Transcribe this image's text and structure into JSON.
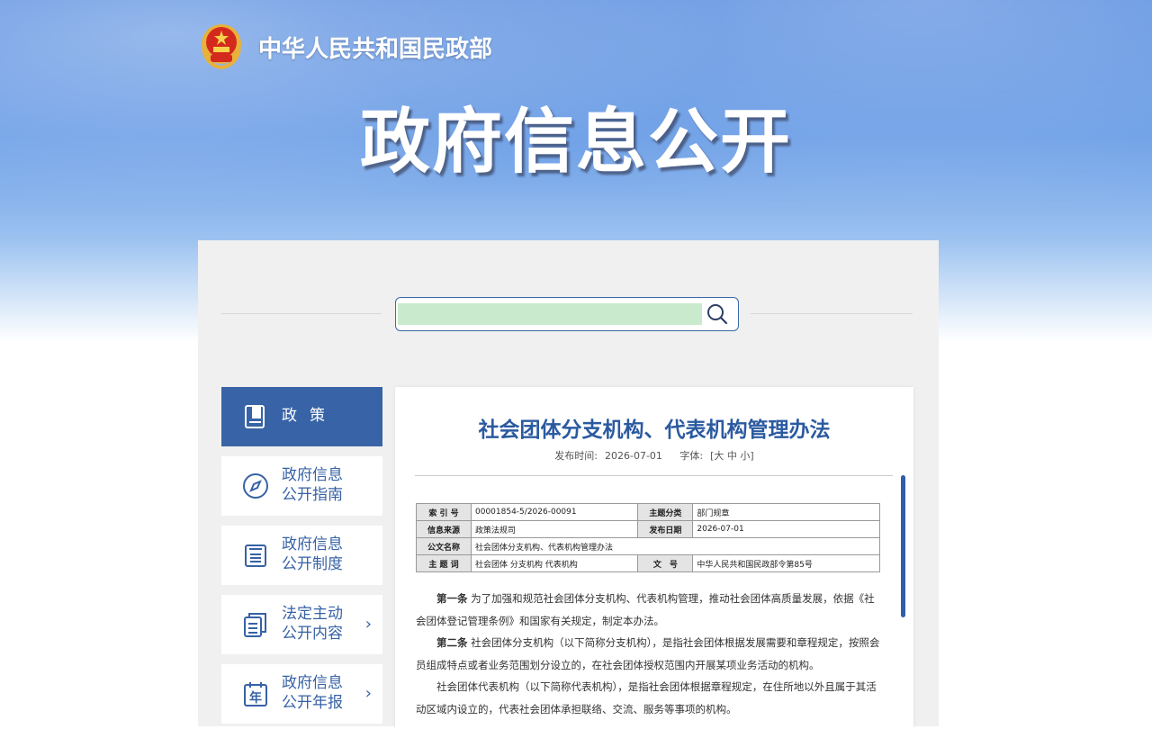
{
  "header": {
    "ministry": "中华人民共和国民政部",
    "title": "政府信息公开"
  },
  "search": {
    "placeholder": ""
  },
  "sidebar": {
    "items": [
      {
        "label": "政策",
        "icon": "book-icon",
        "active": true
      },
      {
        "label": "政府信息公开指南",
        "icon": "compass-icon"
      },
      {
        "label": "政府信息公开制度",
        "icon": "list-document-icon"
      },
      {
        "label": "法定主动公开内容",
        "icon": "documents-icon"
      },
      {
        "label": "政府信息公开年报",
        "icon": "calendar-year-icon",
        "icon_text": "年"
      }
    ]
  },
  "article": {
    "title": "社会团体分支机构、代表机构管理办法",
    "publish_label": "发布时间:",
    "publish_date": "2026-07-01",
    "font_label": "字体:",
    "font_options": "[大 中 小]",
    "info": {
      "index_label": "索 引 号",
      "index_value": "00001854-5/2026-00091",
      "topic_label": "主题分类",
      "topic_value": "部门规章",
      "source_label": "信息来源",
      "source_value": "政策法规司",
      "date_label": "发布日期",
      "date_value": "2026-07-01",
      "doc_label": "公文名称",
      "doc_value": "社会团体分支机构、代表机构管理办法",
      "keyword_label": "主 题 词",
      "keyword_value": "社会团体 分支机构 代表机构",
      "num_label": "文　号",
      "num_value": "中华人民共和国民政部令第85号"
    },
    "paragraphs": [
      {
        "lead": "第一条",
        "text": "为了加强和规范社会团体分支机构、代表机构管理，推动社会团体高质量发展，依据《社会团体登记管理条例》和国家有关规定，制定本办法。"
      },
      {
        "lead": "第二条",
        "text": "社会团体分支机构（以下简称分支机构），是指社会团体根据发展需要和章程规定，按照会员组成特点或者业务范围划分设立的，在社会团体授权范围内开展某项业务活动的机构。"
      },
      {
        "lead": "",
        "text": "社会团体代表机构（以下简称代表机构），是指社会团体根据章程规定，在住所地以外且属于其活动区域内设立的，代表社会团体承担联络、交流、服务等事项的机构。"
      }
    ]
  },
  "colors": {
    "primary": "#3863a6",
    "title_blue": "#2b5aa0",
    "search_fill": "#c9eacd",
    "panel_bg": "#f0f0f0"
  }
}
